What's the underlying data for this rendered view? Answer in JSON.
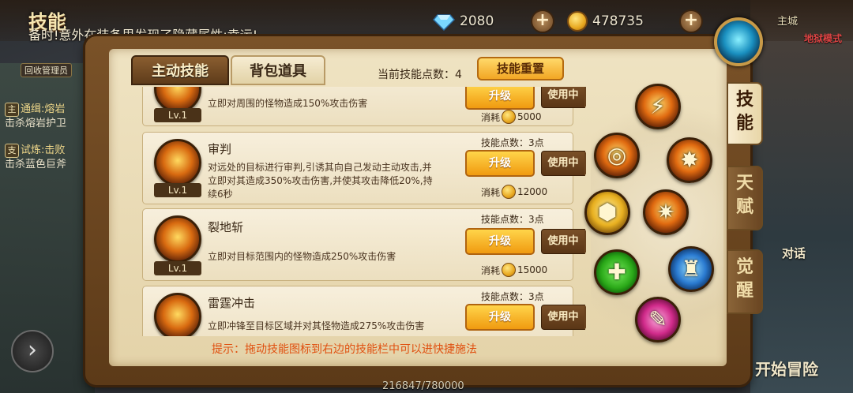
{
  "header": {
    "title": "技能",
    "notice": "备时!意外在装备里发现了隐藏属性:幸运!",
    "diamonds": "2080",
    "gold": "478735",
    "right_text": "主城",
    "mode": "地狱模式"
  },
  "left_panel": {
    "admin_tag": "回收管理员",
    "quests": [
      {
        "tag": "主",
        "title": "通缉:熔岩",
        "detail": "击杀熔岩护卫"
      },
      {
        "tag": "支",
        "title": "试炼:击败",
        "detail": "击杀蓝色巨斧"
      }
    ]
  },
  "tabs": {
    "active": "主动技能",
    "inactive": "背包道具"
  },
  "skill_points": {
    "label": "当前技能点数：",
    "value": "4"
  },
  "reset_button": "技能重置",
  "skills": [
    {
      "name": "",
      "level": "Lv.1",
      "desc": "立即对周围的怪物造成150%攻击伤害",
      "points": "",
      "upgrade": "升级",
      "use": "使用中",
      "cost_label": "消耗",
      "cost": "5000"
    },
    {
      "name": "审判",
      "level": "Lv.1",
      "desc": "对远处的目标进行审判,引诱其向自己发动主动攻击,并立即对其造成350%攻击伤害,并使其攻击降低20%,持续6秒",
      "points": "技能点数：3点",
      "upgrade": "升级",
      "use": "使用中",
      "cost_label": "消耗",
      "cost": "12000"
    },
    {
      "name": "裂地斩",
      "level": "Lv.1",
      "desc": "立即对目标范围内的怪物造成250%攻击伤害",
      "points": "技能点数：3点",
      "upgrade": "升级",
      "use": "使用中",
      "cost_label": "消耗",
      "cost": "15000"
    },
    {
      "name": "雷霆冲击",
      "level": "",
      "desc": "立即冲锋至目标区域并对其怪物造成275%攻击伤害",
      "points": "技能点数：3点",
      "upgrade": "升级",
      "use": "使用中",
      "cost_label": "",
      "cost": ""
    }
  ],
  "hint": "提示：拖动技能图标到右边的技能栏中可以进快捷施法",
  "side_tabs": [
    "技能",
    "天赋",
    "觉醒"
  ],
  "right_buttons": {
    "chat": "对话",
    "adventure": "开始冒险"
  },
  "exp_text": "216847/780000"
}
